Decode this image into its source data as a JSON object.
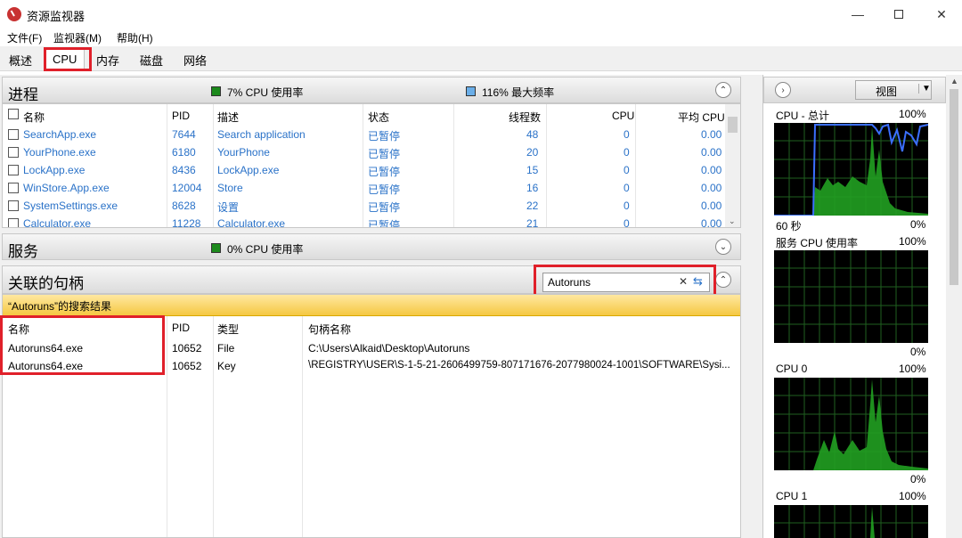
{
  "window": {
    "title": "资源监视器",
    "controls": [
      "minimize",
      "maximize",
      "close"
    ]
  },
  "menu": [
    "文件(F)",
    "监视器(M)",
    "帮助(H)"
  ],
  "tabs": [
    {
      "label": "概述",
      "active": false
    },
    {
      "label": "CPU",
      "active": true
    },
    {
      "label": "内存",
      "active": false
    },
    {
      "label": "磁盘",
      "active": false
    },
    {
      "label": "网络",
      "active": false
    }
  ],
  "processes": {
    "title": "进程",
    "cpu_usage": "7% CPU 使用率",
    "max_freq": "116% 最大频率",
    "columns": [
      "名称",
      "PID",
      "描述",
      "状态",
      "线程数",
      "CPU",
      "平均 CPU"
    ],
    "rows": [
      {
        "name": "SearchApp.exe",
        "pid": "7644",
        "desc": "Search application",
        "status": "已暂停",
        "threads": "48",
        "cpu": "0",
        "avg": "0.00"
      },
      {
        "name": "YourPhone.exe",
        "pid": "6180",
        "desc": "YourPhone",
        "status": "已暂停",
        "threads": "20",
        "cpu": "0",
        "avg": "0.00"
      },
      {
        "name": "LockApp.exe",
        "pid": "8436",
        "desc": "LockApp.exe",
        "status": "已暂停",
        "threads": "15",
        "cpu": "0",
        "avg": "0.00"
      },
      {
        "name": "WinStore.App.exe",
        "pid": "12004",
        "desc": "Store",
        "status": "已暂停",
        "threads": "16",
        "cpu": "0",
        "avg": "0.00"
      },
      {
        "name": "SystemSettings.exe",
        "pid": "8628",
        "desc": "设置",
        "status": "已暂停",
        "threads": "22",
        "cpu": "0",
        "avg": "0.00"
      },
      {
        "name": "Calculator.exe",
        "pid": "11228",
        "desc": "Calculator.exe",
        "status": "已暂停",
        "threads": "21",
        "cpu": "0",
        "avg": "0.00"
      }
    ]
  },
  "services": {
    "title": "服务",
    "cpu_usage": "0% CPU 使用率"
  },
  "handles": {
    "title": "关联的句柄",
    "search_value": "Autoruns",
    "result_banner": "“Autoruns”的搜索结果",
    "columns": [
      "名称",
      "PID",
      "类型",
      "句柄名称"
    ],
    "rows": [
      {
        "name": "Autoruns64.exe",
        "pid": "10652",
        "type": "File",
        "handle": "C:\\Users\\Alkaid\\Desktop\\Autoruns"
      },
      {
        "name": "Autoruns64.exe",
        "pid": "10652",
        "type": "Key",
        "handle": "\\REGISTRY\\USER\\S-1-5-21-2606499759-807171676-2077980024-1001\\SOFTWARE\\Sysi..."
      }
    ]
  },
  "right_panel": {
    "view_label": "视图",
    "graphs": [
      {
        "label": "CPU - 总计",
        "top_value": "100%",
        "bottom_left": "60 秒",
        "bottom_right": "0%"
      },
      {
        "label": "服务 CPU 使用率",
        "top_value": "100%",
        "bottom_right": "0%"
      },
      {
        "label": "CPU 0",
        "top_value": "100%",
        "bottom_right": "0%"
      },
      {
        "label": "CPU 1",
        "top_value": "100%"
      }
    ]
  },
  "colors": {
    "accent_red": "#e0202a",
    "link_blue": "#2a72c8",
    "graph_green": "#21c021",
    "graph_blue": "#3b6fff",
    "banner_yellow": "#f5c842"
  }
}
